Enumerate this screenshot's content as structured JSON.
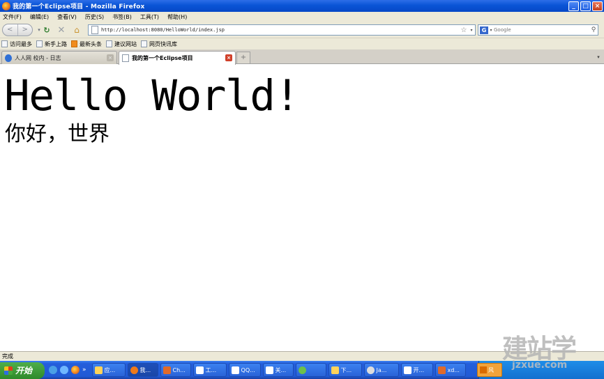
{
  "window": {
    "title": "我的第一个Eclipse项目 - Mozilla Firefox",
    "controls": {
      "minimize": "_",
      "maximize": "□",
      "close": "×"
    }
  },
  "menubar": {
    "items": [
      "文件(F)",
      "编辑(E)",
      "查看(V)",
      "历史(S)",
      "书签(B)",
      "工具(T)",
      "帮助(H)"
    ]
  },
  "navbar": {
    "back": "<",
    "forward": ">",
    "reload_icon": "reload-icon",
    "stop_icon": "stop-icon",
    "home_icon": "home-icon",
    "url": "http://localhost:8080/HelloWorld/index.jsp",
    "search_placeholder": "Google"
  },
  "bookmarks": {
    "items": [
      "访问最多",
      "新手上路",
      "最新头条",
      "建议网站",
      "网页快讯库"
    ]
  },
  "tabs": [
    {
      "label": "人人网 校内 - 日志",
      "active": false
    },
    {
      "label": "我的第一个Eclipse项目",
      "active": true
    }
  ],
  "content": {
    "heading": "Hello World!",
    "subheading": "你好，世界"
  },
  "statusbar": {
    "text": "完成"
  },
  "taskbar": {
    "start": "开始",
    "buttons": [
      "应...",
      "我...",
      "Ch...",
      "工...",
      "QQ...",
      "关...",
      "",
      "下...",
      "Ja...",
      "开...",
      "xd..."
    ],
    "ime": "风"
  },
  "watermark": {
    "text": "建站学",
    "sub": "jzxue.com"
  },
  "colors": {
    "titlebar": "#0a54d6",
    "chrome": "#ece9d8",
    "taskbar": "#245edb",
    "start": "#3c9a36"
  }
}
